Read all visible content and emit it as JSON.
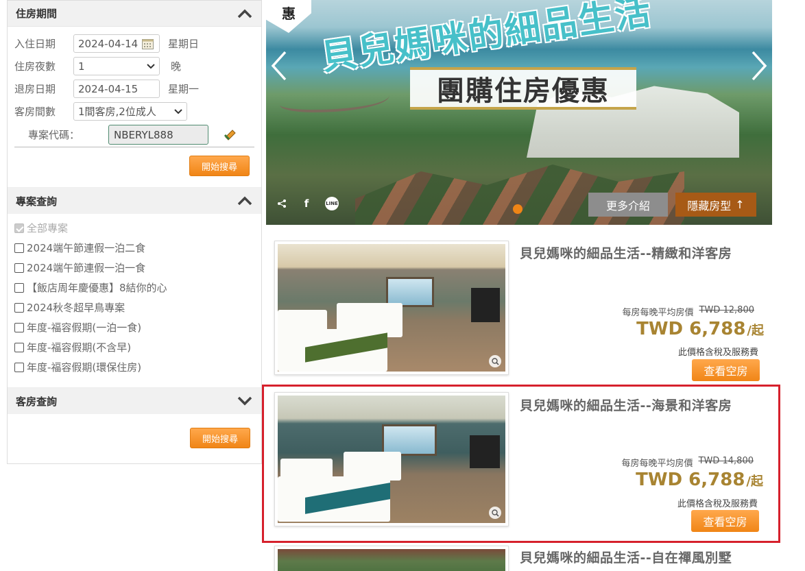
{
  "sidebar": {
    "stay_section": {
      "title": "住房期間",
      "checkin_label": "入住日期",
      "checkin_value": "2024-04-14",
      "checkin_weekday": "星期日",
      "nights_label": "住房夜數",
      "nights_value": "1",
      "nights_unit": "晚",
      "checkout_label": "退房日期",
      "checkout_value": "2024-04-15",
      "checkout_weekday": "星期一",
      "rooms_label": "客房間數",
      "rooms_value": "1間客房,2位成人",
      "promo_label": "專案代碼：",
      "promo_value": "NBERYL888",
      "search_label": "開始搜尋"
    },
    "plan_section": {
      "title": "專案查詢",
      "options": [
        {
          "label": "全部專案",
          "checked": true,
          "disabled": true
        },
        {
          "label": "2024端午節連假一泊二食",
          "checked": false
        },
        {
          "label": "2024端午節連假一泊一食",
          "checked": false
        },
        {
          "label": "【飯店周年慶優惠】8結你的心",
          "checked": false
        },
        {
          "label": "2024秋冬超早鳥專案",
          "checked": false
        },
        {
          "label": "年度-福容假期(一泊一食)",
          "checked": false
        },
        {
          "label": "年度-福容假期(不含早)",
          "checked": false
        },
        {
          "label": "年度-福容假期(環保住房)",
          "checked": false
        }
      ]
    },
    "room_section": {
      "title": "客房查詢",
      "search_label": "開始搜尋"
    }
  },
  "banner": {
    "corner_tag": "惠",
    "title": "貝兒媽咪的細品生活",
    "subtitle": "團購住房優惠",
    "more_label": "更多介紹",
    "hide_label": "隱藏房型",
    "hide_arrow": "↑",
    "share_icons": [
      "share-icon",
      "facebook-icon",
      "line-icon"
    ],
    "line_text": "LINE",
    "facebook_text": "f"
  },
  "rooms": [
    {
      "name": "貝兒媽咪的細品生活--精緻和洋客房",
      "price_caption": "每房每晚平均房價",
      "original_price": "TWD 12,800",
      "sale_price": "TWD 6,788",
      "sale_unit": "/起",
      "tax_note": "此價格含稅及服務費",
      "button_label": "查看空房"
    },
    {
      "name": "貝兒媽咪的細品生活--海景和洋客房",
      "price_caption": "每房每晚平均房價",
      "original_price": "TWD 14,800",
      "sale_price": "TWD 6,788",
      "sale_unit": "/起",
      "tax_note": "此價格含稅及服務費",
      "button_label": "查看空房",
      "highlighted": true
    },
    {
      "name": "貝兒媽咪的細品生活--自在禪風別墅"
    }
  ],
  "colors": {
    "accent_orange": "#f08516",
    "price_gold": "#a88432",
    "highlight_red": "#d6202c",
    "hide_button_brown": "#a75a16"
  }
}
